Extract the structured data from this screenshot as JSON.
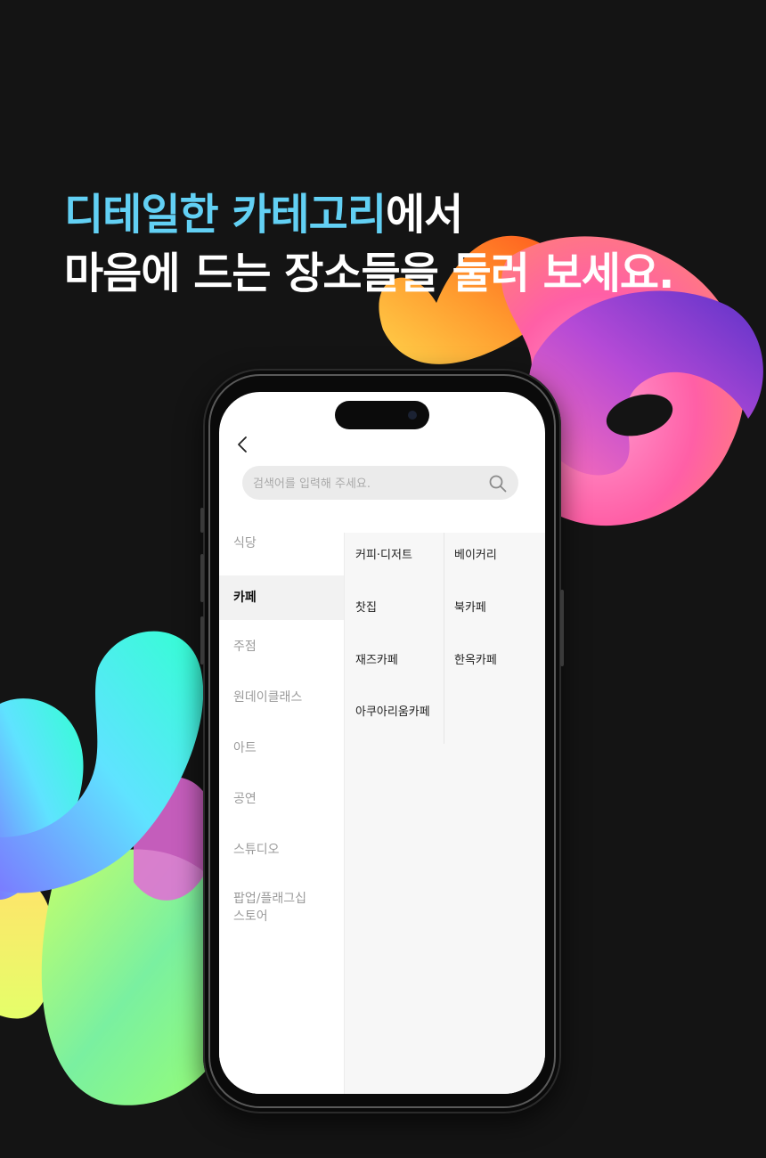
{
  "headline": {
    "line1_accent": "디테일한 카테고리",
    "line1_rest": "에서",
    "line2": "마음에 드는 장소들을 둘러 보세요."
  },
  "colors": {
    "background": "#141414",
    "accent": "#62d0f4",
    "active_category_bg": "#f2f2f2",
    "search_bg": "#ebebeb"
  },
  "search": {
    "placeholder": "검색어를 입력해 주세요."
  },
  "icons": {
    "back": "chevron-left-icon",
    "search": "search-icon"
  },
  "categories": [
    {
      "label": "식당",
      "active": false
    },
    {
      "label": "카페",
      "active": true
    },
    {
      "label": "주점",
      "active": false
    },
    {
      "label": "원데이클래스",
      "active": false
    },
    {
      "label": "아트",
      "active": false
    },
    {
      "label": "공연",
      "active": false
    },
    {
      "label": "스튜디오",
      "active": false
    },
    {
      "label_line1": "팝업/플래그십",
      "label_line2": "스토어",
      "active": false
    }
  ],
  "subcategories": {
    "left_column": [
      "커피·디저트",
      "찻집",
      "재즈카페",
      "아쿠아리움카페"
    ],
    "right_column": [
      "베이커리",
      "북카페",
      "한옥카페"
    ]
  }
}
